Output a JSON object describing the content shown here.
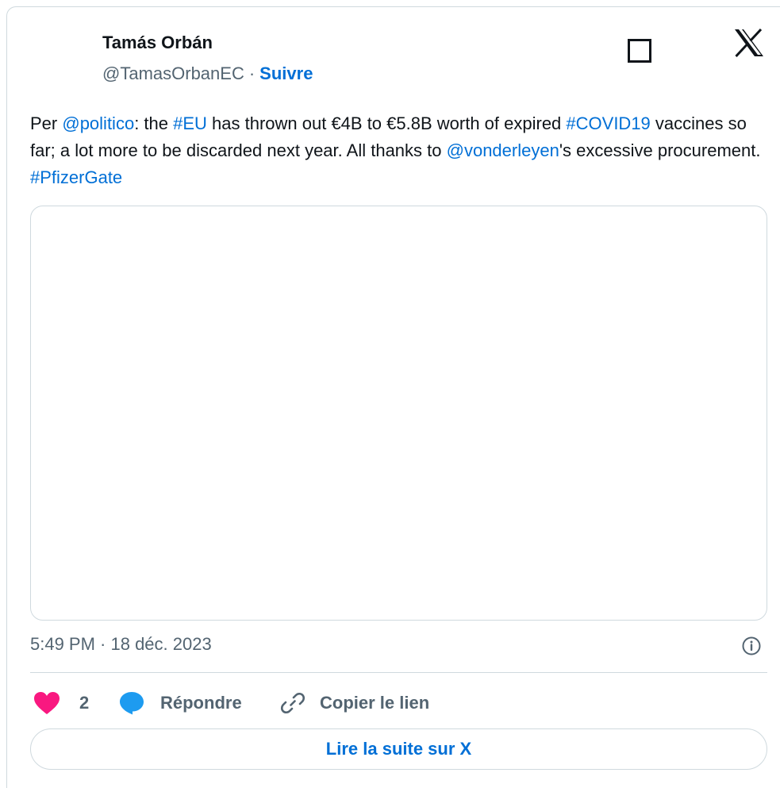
{
  "author": {
    "name": "Tamás Orbán",
    "handle": "@TamasOrbanEC",
    "separator": "·",
    "follow_label": "Suivre"
  },
  "tweet": {
    "segments": [
      {
        "text": "Per ",
        "link": false
      },
      {
        "text": "@politico",
        "link": true
      },
      {
        "text": ": the ",
        "link": false
      },
      {
        "text": "#EU",
        "link": true
      },
      {
        "text": " has thrown out €4B to €5.8B worth of expired ",
        "link": false
      },
      {
        "text": "#COVID19",
        "link": true
      },
      {
        "text": " vaccines so far; a lot more to be discarded next year. All thanks to ",
        "link": false
      },
      {
        "text": "@vonderleyen",
        "link": true
      },
      {
        "text": "'s excessive procurement. ",
        "link": false
      },
      {
        "text": "#PfizerGate",
        "link": true
      }
    ],
    "timestamp": "5:49 PM · 18 déc. 2023"
  },
  "actions": {
    "like_count": "2",
    "reply_label": "Répondre",
    "copy_link_label": "Copier le lien"
  },
  "read_more_label": "Lire la suite sur X",
  "icons": {
    "brand": "x-logo-icon",
    "square": "square-icon",
    "info": "info-icon",
    "heart": "heart-icon",
    "reply": "speech-bubble-icon",
    "link": "link-icon"
  },
  "colors": {
    "text": "#0f1419",
    "muted": "#536471",
    "link": "#006fd6",
    "heart": "#f91880",
    "reply": "#1d9bf0",
    "border": "#cfd9de"
  }
}
